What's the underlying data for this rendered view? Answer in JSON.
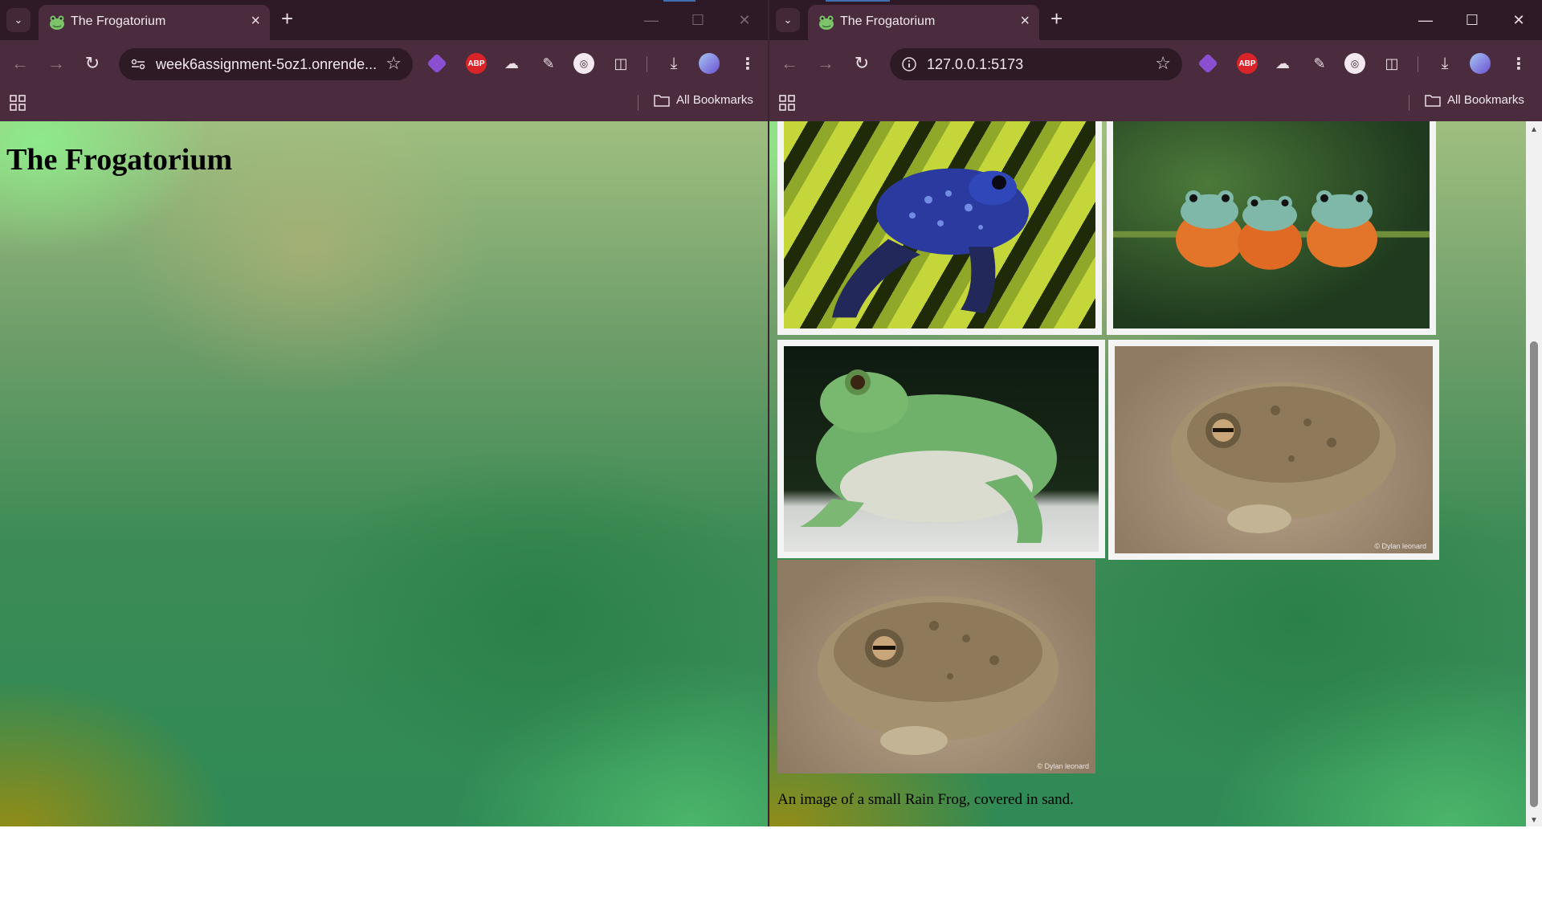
{
  "left_window": {
    "tab_title": "The Frogatorium",
    "url": "week6assignment-5oz1.onrende...",
    "bookmarks_label": "All Bookmarks",
    "page": {
      "heading": "The Frogatorium"
    }
  },
  "right_window": {
    "tab_title": "The Frogatorium",
    "url": "127.0.0.1:5173",
    "bookmarks_label": "All Bookmarks",
    "page": {
      "images": [
        {
          "subject": "blue poison dart frog on leaf"
        },
        {
          "subject": "three flying frogs on a vine"
        },
        {
          "subject": "green tree frog"
        },
        {
          "subject": "rain frog in sand",
          "watermark": "© Dylan leonard"
        },
        {
          "subject": "rain frog in sand (enlarged)",
          "watermark": "© Dylan leonard"
        }
      ],
      "caption": "An image of a small Rain Frog, covered in sand."
    }
  },
  "icons": {
    "tab_search": "chevron-down-icon",
    "new_tab": "plus-icon",
    "back": "arrow-left-icon",
    "forward": "arrow-right-icon",
    "reload": "reload-icon",
    "bookmark": "star-icon",
    "extensions": [
      "diamond-icon",
      "abp-icon",
      "cloud-icon",
      "eyedropper-icon",
      "circle-logo-icon",
      "puzzle-icon"
    ],
    "download": "download-icon",
    "menu": "kebab-icon"
  },
  "colors": {
    "chrome_bg": "#4a2c3e",
    "tabstrip_bg": "#2e1a26",
    "omnibox_bg": "#2d1a25"
  }
}
